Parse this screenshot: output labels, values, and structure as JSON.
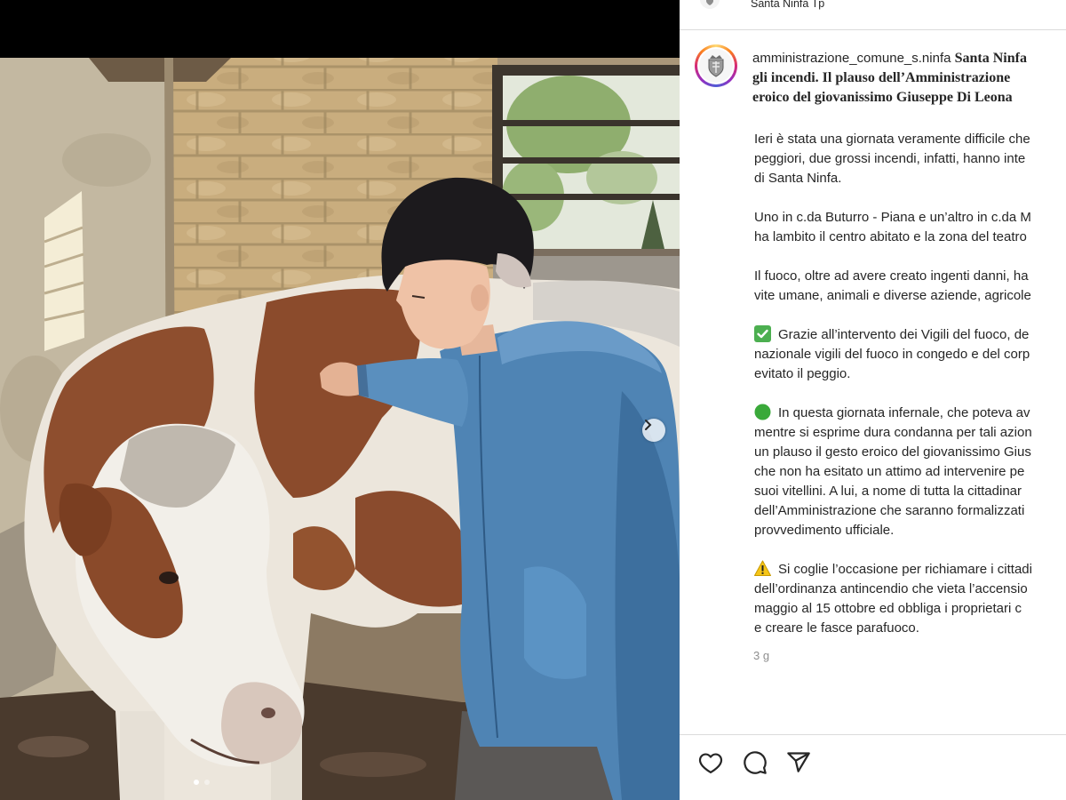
{
  "header": {
    "location": "Santa Ninfa Tp",
    "avatar_icon": "crest-icon"
  },
  "photo": {
    "carousel": {
      "total": 2,
      "active": 1
    },
    "next_icon": "chevron-right-icon"
  },
  "caption": {
    "avatar_icon": "crest-icon",
    "username": "amministrazione_comune_s.ninfa",
    "title": [
      "Santa Ninfa",
      "gli incendi. Il plauso dell’Amministrazione",
      "eroico del giovanissimo Giuseppe Di Leona"
    ],
    "paragraphs": [
      {
        "lines": [
          "Ieri è stata una giornata veramente difficile che",
          "peggiori, due grossi incendi, infatti, hanno inte",
          "di Santa Ninfa."
        ]
      },
      {
        "lines": [
          "Uno in c.da Buturro - Piana e un’altro in c.da M",
          "ha lambito il centro abitato e la zona del teatro"
        ]
      },
      {
        "lines": [
          "Il fuoco, oltre ad avere creato ingenti danni, ha",
          "vite umane, animali e diverse aziende, agricole"
        ]
      },
      {
        "icon": "check-mark-button-icon",
        "lines": [
          "Grazie all’intervento dei Vigili del fuoco, de",
          "nazionale vigili del fuoco in congedo e del corp",
          "evitato il peggio."
        ]
      },
      {
        "icon": "green-circle-icon",
        "lines": [
          "In questa giornata infernale, che poteva av",
          "mentre si esprime dura condanna per tali azion",
          "un plauso il gesto eroico del giovanissimo Gius",
          "che non ha esitato un attimo ad intervenire pe",
          "suoi vitellini. A lui, a nome di tutta la cittadinar",
          "dell’Amministrazione che saranno formalizzati",
          "provvedimento ufficiale."
        ]
      },
      {
        "icon": "warning-icon",
        "lines": [
          "Si coglie l’occasione per richiamare i cittadi",
          "dell’ordinanza antincendio che vieta l’accensio",
          "maggio al 15 ottobre ed obbliga i proprietari c",
          "e creare le fasce parafuoco."
        ]
      }
    ]
  },
  "timestamp": "3 g",
  "actions": {
    "like_icon": "heart-icon",
    "comment_icon": "comment-icon",
    "share_icon": "send-icon"
  },
  "colors": {
    "text": "#262626",
    "muted": "#8e8e8e",
    "divider": "#dbdbdb"
  }
}
